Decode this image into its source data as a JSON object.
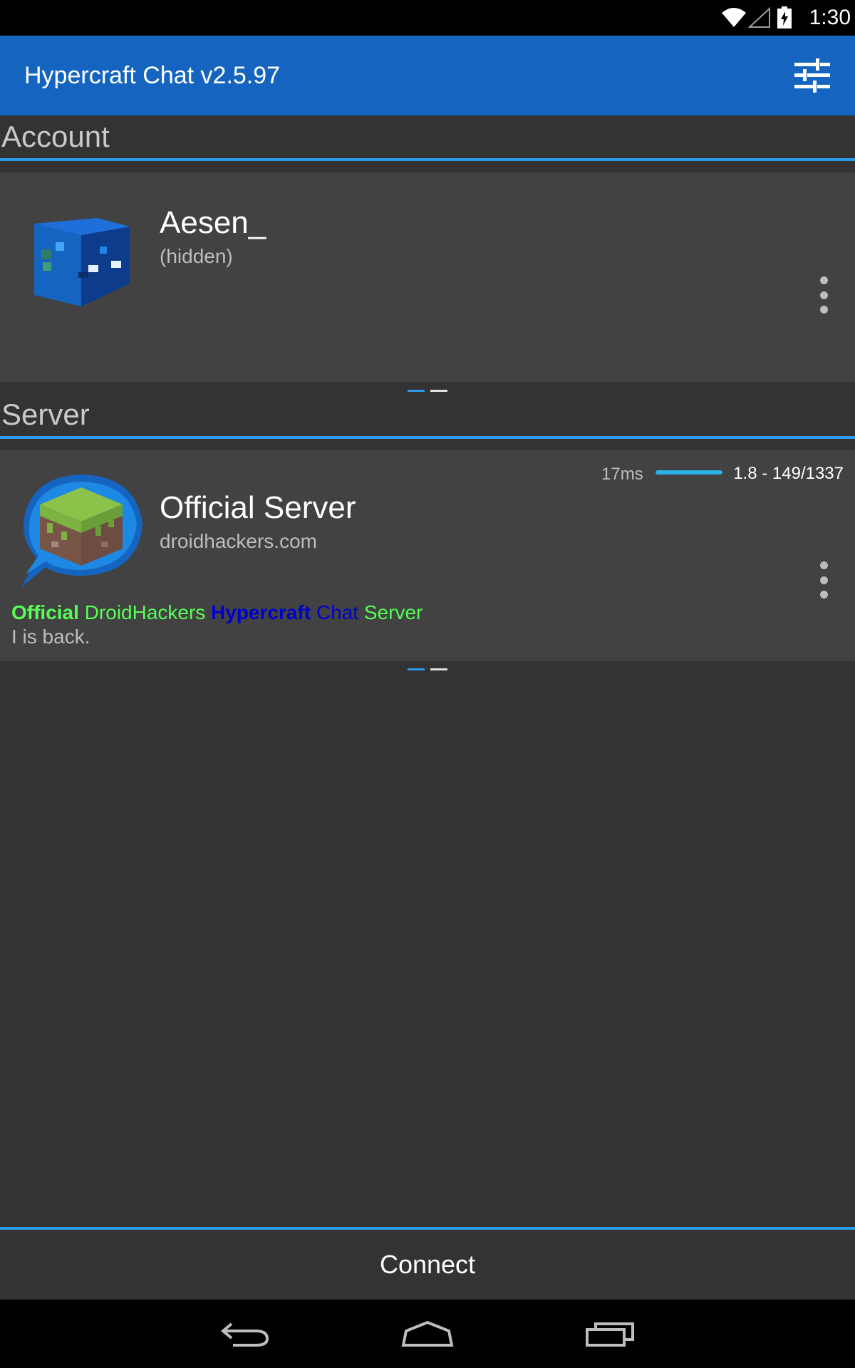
{
  "status_bar": {
    "time": "1:30",
    "icons": [
      "wifi-icon",
      "signal-icon",
      "battery-charging-icon"
    ]
  },
  "app_bar": {
    "title": "Hypercraft Chat v2.5.97",
    "action_icon": "tune-sliders-icon"
  },
  "account_section": {
    "header": "Account",
    "name": "Aesen_",
    "subtitle": "(hidden)",
    "avatar_icon": "minecraft-head-avatar",
    "menu_icon": "more-vert-icon",
    "pager_active_index": 0
  },
  "server_section": {
    "header": "Server",
    "name": "Official Server",
    "host": "droidhackers.com",
    "ping": "17ms",
    "ping_fill_percent": 100,
    "version_players": "1.8 - 149/1337",
    "motd_line1": [
      "Official",
      "DroidHackers",
      "Hypercraft",
      "Chat",
      "Server"
    ],
    "motd_line2": "I is back.",
    "motd_colors": {
      "green": "#55ff55",
      "blue": "#0000cc"
    },
    "server_icon": "grass-block-chat-bubble-icon",
    "menu_icon": "more-vert-icon",
    "pager_active_index": 0
  },
  "connect_button": {
    "label": "Connect"
  },
  "nav_bar": {
    "icons": [
      "back-icon",
      "home-icon",
      "recents-icon"
    ]
  },
  "colors": {
    "accent": "#2b9ae8",
    "app_bar": "#1565c0",
    "background": "#333333",
    "card": "#424242"
  }
}
